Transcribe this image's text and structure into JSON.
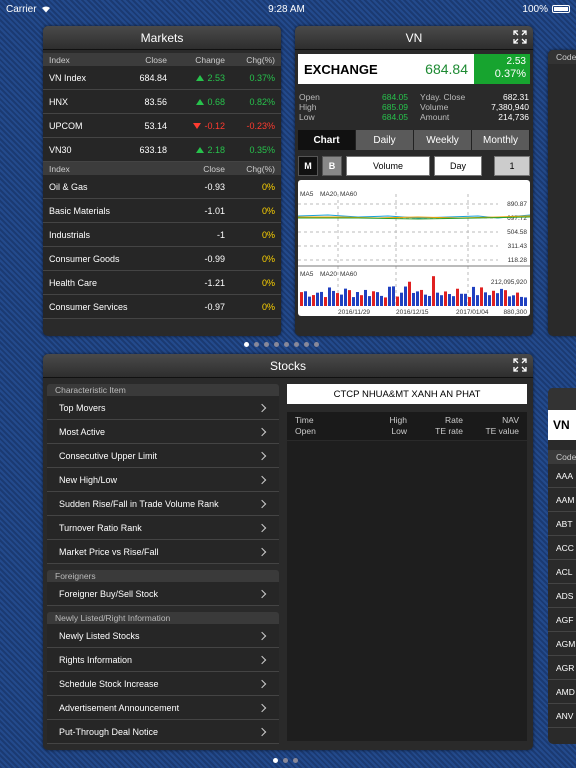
{
  "status": {
    "carrier": "Carrier",
    "time": "9:28 AM",
    "battery": "100%"
  },
  "markets": {
    "title": "Markets",
    "header1": {
      "index": "Index",
      "close": "Close",
      "change": "Change",
      "chg": "Chg(%)"
    },
    "indices": [
      {
        "name": "VN Index",
        "close": "684.84",
        "change": "2.53",
        "dir": "up",
        "pct": "0.37%"
      },
      {
        "name": "HNX",
        "close": "83.56",
        "change": "0.68",
        "dir": "up",
        "pct": "0.82%"
      },
      {
        "name": "UPCOM",
        "close": "53.14",
        "change": "-0.12",
        "dir": "down",
        "pct": "-0.23%"
      },
      {
        "name": "VN30",
        "close": "633.18",
        "change": "2.18",
        "dir": "up",
        "pct": "0.35%"
      }
    ],
    "header2": {
      "index": "Index",
      "close": "Close",
      "chg": "Chg(%)"
    },
    "sectors": [
      {
        "name": "Oil & Gas",
        "close": "-0.93",
        "pct": "0%"
      },
      {
        "name": "Basic Materials",
        "close": "-1.01",
        "pct": "0%"
      },
      {
        "name": "Industrials",
        "close": "-1",
        "pct": "0%"
      },
      {
        "name": "Consumer Goods",
        "close": "-0.99",
        "pct": "0%"
      },
      {
        "name": "Health Care",
        "close": "-1.21",
        "pct": "0%"
      },
      {
        "name": "Consumer Services",
        "close": "-0.97",
        "pct": "0%"
      }
    ]
  },
  "vn": {
    "title": "VN",
    "exchange": "EXCHANGE",
    "value": "684.84",
    "change": "2.53",
    "pct": "0.37%",
    "stats_left": {
      "labels": [
        "Open",
        "High",
        "Low"
      ],
      "values": [
        "684.05",
        "685.09",
        "684.05"
      ]
    },
    "stats_right": {
      "labels": [
        "Yday. Close",
        "Volume",
        "Amount"
      ],
      "values": [
        "682.31",
        "7,380,940",
        "214,736"
      ]
    },
    "tabs": [
      "Chart",
      "Daily",
      "Weekly",
      "Monthly"
    ],
    "controls": {
      "m": "M",
      "b": "B",
      "type": "Volume",
      "period": "Day",
      "count": "1"
    },
    "chart": {
      "ma_labels": [
        "MA5",
        "MA20",
        "MA60"
      ],
      "price_ticks": [
        "890.87",
        "697.72",
        "504.58",
        "311.43",
        "118.28"
      ],
      "vol_ticks": [
        "212,095,920",
        "880,300"
      ],
      "dates": [
        "2016/11/29",
        "2016/12/15",
        "2017/01/04"
      ]
    }
  },
  "side_top": {
    "label": "Code"
  },
  "stocks": {
    "title": "Stocks",
    "sections": [
      {
        "header": "Characteristic Item",
        "items": [
          "Top Movers",
          "Most Active",
          "Consecutive Upper Limit",
          "New High/Low",
          "Sudden Rise/Fall in Trade Volume Rank",
          "Turnover Ratio Rank",
          "Market Price vs Rise/Fall"
        ]
      },
      {
        "header": "Foreigners",
        "items": [
          "Foreigner Buy/Sell Stock"
        ]
      },
      {
        "header": "Newly Listed/Right Information",
        "items": [
          "Newly Listed Stocks",
          "Rights Information",
          "Schedule Stock Increase",
          "Advertisement Announcement",
          "Put-Through Deal Notice"
        ]
      }
    ],
    "company": "CTCP NHUA&MT XANH AN PHAT",
    "table_head": {
      "c1a": "Time",
      "c1b": "Open",
      "c2a": "High",
      "c2b": "Low",
      "c3a": "Rate",
      "c3b": "TE rate",
      "c4a": "NAV",
      "c4b": "TE value"
    }
  },
  "side_bottom": {
    "vn": "VN",
    "code": "Code",
    "codes": [
      "AAA",
      "AAM",
      "ABT",
      "ACC",
      "ACL",
      "ADS",
      "AGF",
      "AGM",
      "AGR",
      "AMD",
      "ANV"
    ]
  },
  "colors": {
    "up": "#27c24c",
    "down": "#ff3b30",
    "flat": "#ffd400"
  }
}
